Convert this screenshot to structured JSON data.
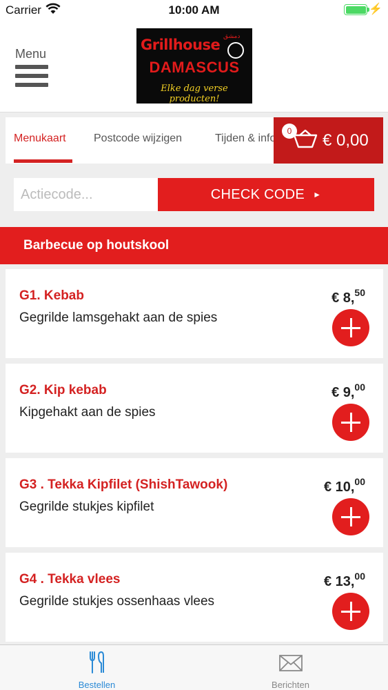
{
  "status_bar": {
    "carrier": "Carrier",
    "time": "10:00 AM"
  },
  "header": {
    "menu_label": "Menu",
    "logo": {
      "line1": "Grillhouse",
      "line2": "DAMASCUS",
      "line3": "Elke dag verse producten!"
    }
  },
  "tabs": [
    {
      "label": "Menukaart",
      "active": true
    },
    {
      "label": "Postcode wijzigen",
      "active": false
    },
    {
      "label": "Tijden & info",
      "active": false
    }
  ],
  "cart": {
    "count": "0",
    "total": "€ 0,00"
  },
  "action_code": {
    "placeholder": "Actiecode...",
    "button_label": "CHECK CODE",
    "button_arrow": "►"
  },
  "category": {
    "title": "Barbecue op houtskool"
  },
  "products": [
    {
      "name": "G1. Kebab",
      "description": "Gegrilde lamsgehakt aan de spies",
      "price_main": "€ 8,",
      "price_cents": "50"
    },
    {
      "name": "G2. Kip kebab",
      "description": "Kipgehakt aan de spies",
      "price_main": "€ 9,",
      "price_cents": "00"
    },
    {
      "name": "G3 . Tekka Kipfilet (ShishTawook)",
      "description": "Gegrilde stukjes kipfilet",
      "price_main": "€ 10,",
      "price_cents": "00"
    },
    {
      "name": "G4 . Tekka vlees",
      "description": "Gegrilde stukjes ossenhaas vlees",
      "price_main": "€ 13,",
      "price_cents": "00"
    }
  ],
  "bottom_tabs": [
    {
      "label": "Bestellen",
      "active": true,
      "icon": "fork-knife-icon"
    },
    {
      "label": "Berichten",
      "active": false,
      "icon": "envelope-icon"
    }
  ],
  "colors": {
    "brand_red": "#e21e1e",
    "cart_red": "#c21a1a",
    "active_tab_blue": "#2a8ad6"
  }
}
